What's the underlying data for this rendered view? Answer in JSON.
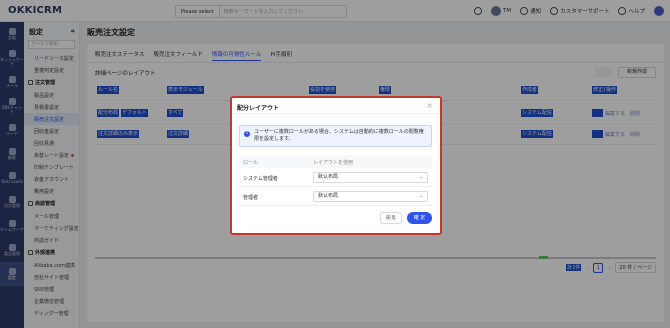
{
  "topbar": {
    "logo": "OKKICRM",
    "search_select": "Please select",
    "search_placeholder": "検索キーワードを入力してください",
    "user": "TM",
    "notices": "通知",
    "support": "カスタマーサポート",
    "help": "ヘルプ"
  },
  "rail": [
    "全般",
    "ダッシュボード",
    "メール",
    "SNSチャット",
    "リード",
    "顧客",
    "Okki Leads",
    "注文管理",
    "チームワーク",
    "製品管理",
    "設定"
  ],
  "sidebar": {
    "title": "設定",
    "search_placeholder": "ラベルで検索",
    "items_top": [
      "リードソース設定",
      "重複判定設定"
    ],
    "order_group": "注文管理",
    "order_items": [
      "製品設定",
      "見積書設定",
      "販売注文設定",
      "回収金設定",
      "回収見通",
      "為替レート設定",
      "印刷テンプレート",
      "資金アカウント",
      "費用設定"
    ],
    "mail_group": "商談管理",
    "mail_items": [
      "メール管理",
      "マーケティング設定",
      "商談ガイド"
    ],
    "ext_group": "外部連携",
    "ext_items": [
      "Alibaba.com連携",
      "自社サイト管理",
      "SNS管理",
      "企業微信管理",
      "ディングー管理"
    ]
  },
  "main": {
    "title": "販売注文設定",
    "tabs": [
      "販売注文ステータス",
      "販売注文フィールド",
      "情報の可視性ルール",
      "PI手順別"
    ],
    "active_tab_index": 2,
    "layout_label": "詳細ページのレイアウト",
    "new_button": "新規作成",
    "columns": [
      "ルール名",
      "表示モジュール",
      "役割を使用",
      "権限",
      "作成者",
      "修正日",
      "操作"
    ],
    "rows": [
      {
        "name": "配分布局",
        "default_tag": "デフォルト",
        "module": "すべて",
        "creator": "システム配信",
        "edit": "編集する",
        "delete": "削除"
      },
      {
        "name": "注文詳細のみ表示",
        "module": "注文詳細",
        "creator": "システム配信",
        "edit": "編集する",
        "delete": "削除"
      }
    ],
    "pagination": {
      "total": "計2件",
      "page": "1",
      "size": "20 件 / ページ"
    }
  },
  "modal": {
    "title": "配分レイアウト",
    "notice": "ユーザーに複数ロールがある場合、システムは自動的に複数ロールの閲覧権限を設定します。",
    "col_role": "ロール",
    "col_layout": "レイアウトを使用",
    "rows": [
      {
        "role": "システム管理者",
        "layout": "默认布局"
      },
      {
        "role": "管理者",
        "layout": "默认布局"
      }
    ],
    "cancel": "戻る",
    "ok": "確 定"
  }
}
